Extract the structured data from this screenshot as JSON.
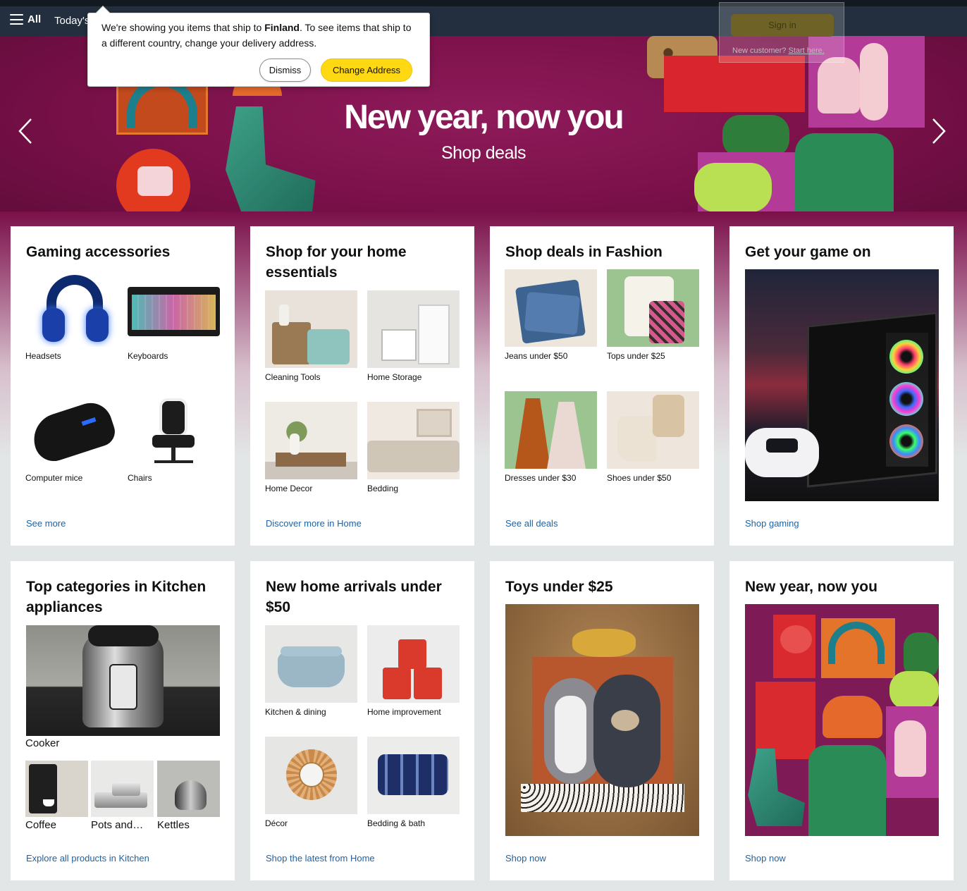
{
  "nav": {
    "all_label": "All",
    "todays_label": "Today's Deals"
  },
  "location_popover": {
    "message_prefix": "We're showing you items that ship to ",
    "country": "Finland",
    "message_suffix": ". To see items that ship to a different country, change your delivery address.",
    "dismiss_label": "Dismiss",
    "change_label": "Change Address"
  },
  "signin_flyout": {
    "button_label": "Sign in",
    "new_customer": "New customer?",
    "start_here": "Start here."
  },
  "hero": {
    "title": "New year, now you",
    "subtitle": "Shop deals",
    "bg_color": "#7a1049"
  },
  "cards": [
    {
      "title": "Gaming accessories",
      "tiles": [
        "Headsets",
        "Keyboards",
        "Computer mice",
        "Chairs"
      ],
      "footer": "See more"
    },
    {
      "title": "Shop for your home essentials",
      "tiles": [
        "Cleaning Tools",
        "Home Storage",
        "Home Decor",
        "Bedding"
      ],
      "footer": "Discover more in Home"
    },
    {
      "title": "Shop deals in Fashion",
      "tiles": [
        "Jeans under $50",
        "Tops under $25",
        "Dresses under $30",
        "Shoes under $50"
      ],
      "footer": "See all deals"
    },
    {
      "title": "Get your game on",
      "footer": "Shop gaming"
    },
    {
      "title": "Top categories in Kitchen appliances",
      "main_caption": "Cooker",
      "small_captions": [
        "Coffee",
        "Pots and…",
        "Kettles"
      ],
      "footer": "Explore all products in Kitchen"
    },
    {
      "title": "New home arrivals under $50",
      "tiles": [
        "Kitchen & dining",
        "Home improvement",
        "Décor",
        "Bedding & bath"
      ],
      "footer": "Shop the latest from Home"
    },
    {
      "title": "Toys under $25",
      "footer": "Shop now"
    },
    {
      "title": "New year, now you",
      "footer": "Shop now"
    }
  ],
  "colors": {
    "link": "#2162a1",
    "primary_button": "#ffd814",
    "nav_bg": "#232f3e",
    "page_bg": "#e3e6e6"
  }
}
